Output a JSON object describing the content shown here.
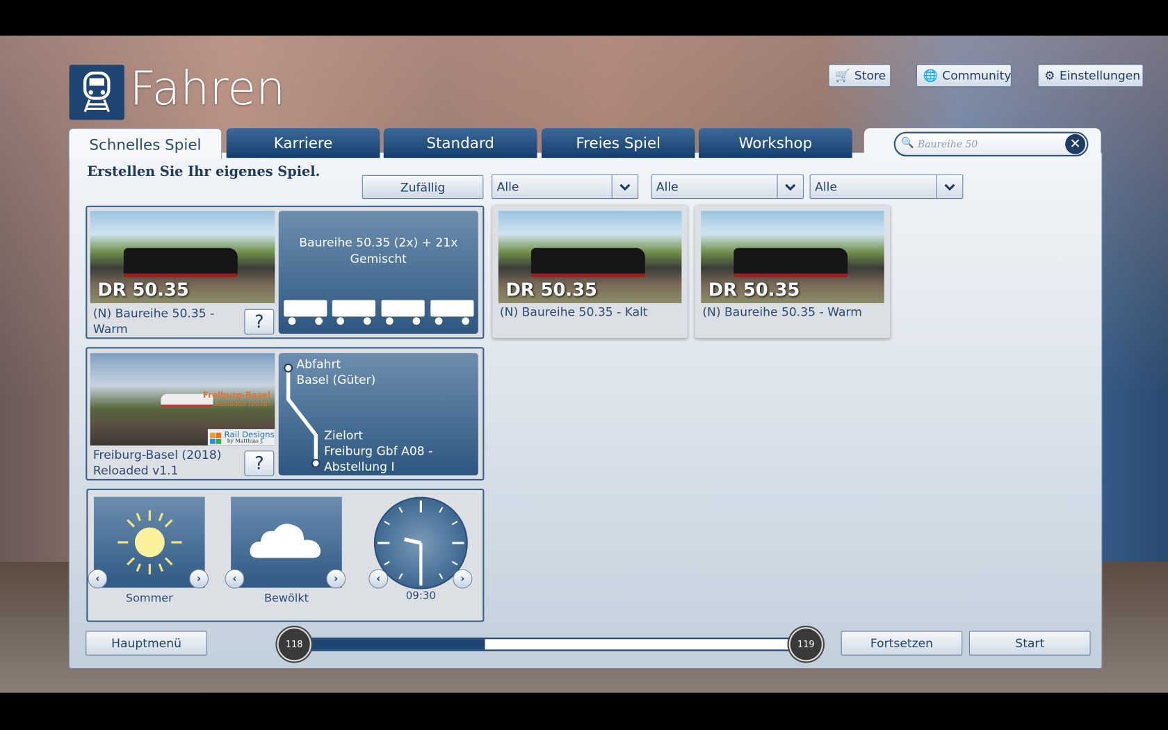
{
  "header": {
    "title": "Fahren",
    "logo_icon": "train-icon"
  },
  "top_buttons": {
    "store": "Store",
    "community": "Community",
    "settings": "Einstellungen"
  },
  "tabs": [
    {
      "label": "Schnelles Spiel",
      "active": true
    },
    {
      "label": "Karriere"
    },
    {
      "label": "Standard"
    },
    {
      "label": "Freies Spiel"
    },
    {
      "label": "Workshop"
    }
  ],
  "search": {
    "value": "Baureihe 50"
  },
  "main": {
    "heading": "Erstellen Sie Ihr eigenes Spiel.",
    "random_label": "Zufällig",
    "filters": [
      "Alle",
      "Alle",
      "Alle"
    ]
  },
  "loco": {
    "badge": "DR 50.35",
    "name": "(N) Baureihe 50.35  -\nWarm",
    "consist": "Baureihe 50.35 (2x) + 21x Gemischt",
    "help": "?"
  },
  "route": {
    "name": "Freiburg-Basel (2018) Reloaded v1.1",
    "image_title": "Freiburg-Basel",
    "image_sub": "Reloaded (2018)",
    "brand": "Rail Designs",
    "brand_sub": "by Matthias J.",
    "departure_label": "Abfahrt",
    "departure": "Basel (Güter)",
    "destination_label": "Zielort",
    "destination": "Freiburg Gbf A08 - Abstellung I",
    "help": "?"
  },
  "conditions": {
    "season": "Sommer",
    "weather": "Bewölkt",
    "time": "09:30"
  },
  "results": [
    {
      "badge": "DR 50.35",
      "name": "(N) Baureihe 50.35  - Kalt"
    },
    {
      "badge": "DR 50.35",
      "name": "(N) Baureihe 50.35  - Warm"
    }
  ],
  "footer": {
    "main_menu": "Hauptmenü",
    "continue": "Fortsetzen",
    "start": "Start",
    "level_current": "118",
    "level_next": "119",
    "progress_percent": 37
  },
  "colors": {
    "accent": "#1f4572",
    "tab": "#1e4a78"
  }
}
